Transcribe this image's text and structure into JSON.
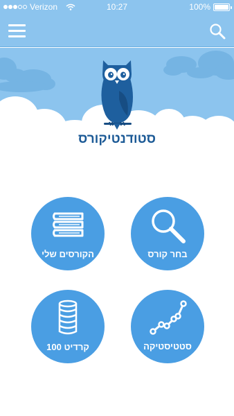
{
  "status_bar": {
    "carrier": "Verizon",
    "time": "10:27",
    "battery": "100%"
  },
  "app": {
    "title": "סטודנטיקורס"
  },
  "navbar": {
    "menu_icon": "hamburger-menu-icon",
    "search_icon": "search-icon"
  },
  "tiles": [
    {
      "label": "בחר קורס",
      "icon": "magnifier-icon"
    },
    {
      "label": "הקורסים שלי",
      "icon": "books-stack-icon"
    },
    {
      "label": "סטטיסטיקה",
      "icon": "line-graph-icon"
    },
    {
      "label": "קרדיט 100",
      "icon": "coin-stack-icon"
    }
  ],
  "colors": {
    "sky": "#8cc4ee",
    "tile": "#4a9ee3",
    "title": "#1c5a96",
    "owl": "#1e5f9e"
  }
}
